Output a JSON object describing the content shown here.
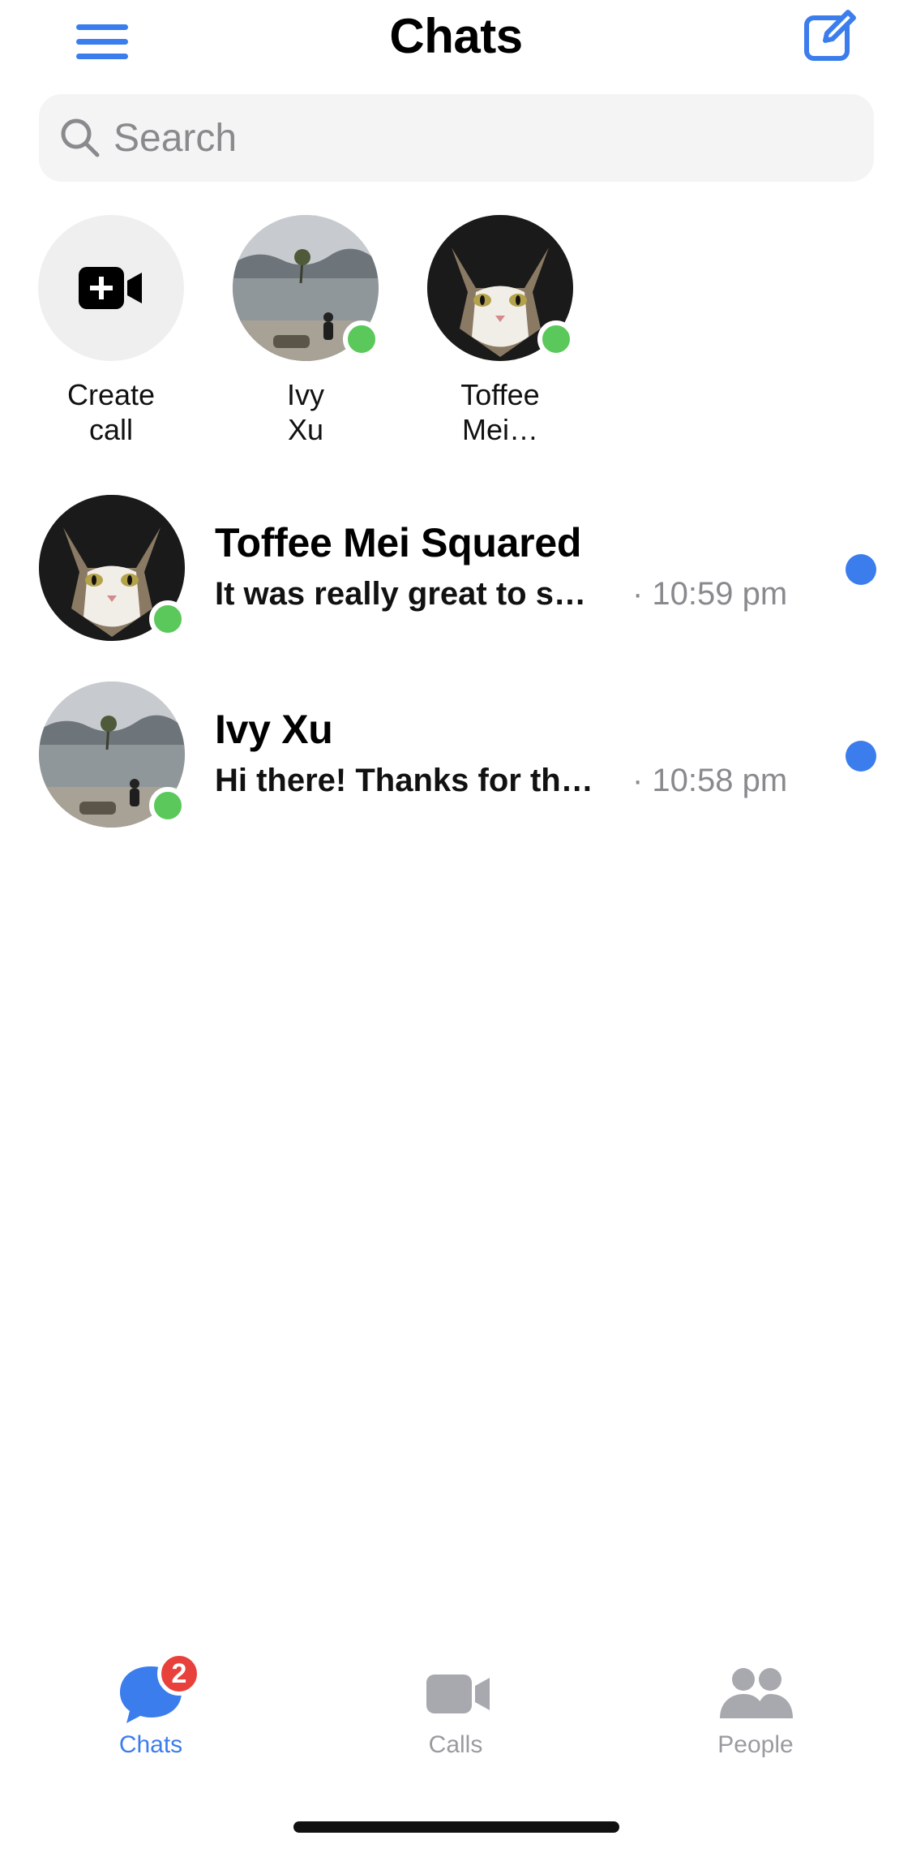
{
  "header": {
    "title": "Chats",
    "menu_icon": "hamburger-menu-icon",
    "compose_icon": "compose-icon"
  },
  "search": {
    "placeholder": "Search",
    "value": ""
  },
  "stories": [
    {
      "label": "Create\ncall",
      "icon": "video-plus-icon"
    },
    {
      "label": "Ivy\nXu",
      "online": true,
      "avatar": "lake-photo"
    },
    {
      "label": "Toffee\nMei…",
      "online": true,
      "avatar": "cat-photo"
    }
  ],
  "chats": [
    {
      "name": "Toffee Mei Squared",
      "preview": "It was really great to s…",
      "time": "· 10:59 pm",
      "online": true,
      "unread": true,
      "avatar": "cat-photo"
    },
    {
      "name": "Ivy Xu",
      "preview": "Hi there! Thanks for th…",
      "time": "· 10:58 pm",
      "online": true,
      "unread": true,
      "avatar": "lake-photo"
    }
  ],
  "tabbar": {
    "tabs": [
      {
        "label": "Chats",
        "icon": "chat-bubble-icon",
        "active": true,
        "badge": "2"
      },
      {
        "label": "Calls",
        "icon": "video-camera-icon",
        "active": false
      },
      {
        "label": "People",
        "icon": "people-icon",
        "active": false
      }
    ]
  },
  "colors": {
    "accent": "#3b7ded",
    "online": "#5ac85a",
    "badge": "#e8413c",
    "muted": "#8a8a8e"
  }
}
